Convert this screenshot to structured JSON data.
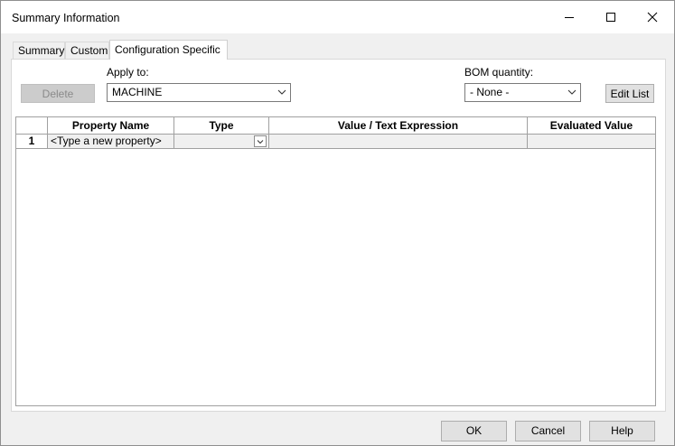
{
  "window": {
    "title": "Summary Information"
  },
  "tabs": [
    {
      "label": "Summary",
      "active": false
    },
    {
      "label": "Custom",
      "active": false
    },
    {
      "label": "Configuration Specific",
      "active": true
    }
  ],
  "toolbar": {
    "delete_label": "Delete",
    "apply_to_label": "Apply to:",
    "apply_to_value": "MACHINE",
    "bom_quantity_label": "BOM quantity:",
    "bom_quantity_value": "- None -",
    "edit_list_label": "Edit List"
  },
  "table": {
    "columns": [
      "",
      "Property Name",
      "Type",
      "Value / Text Expression",
      "Evaluated Value"
    ],
    "rows": [
      {
        "num": "1",
        "property_name": "<Type a new property>",
        "type": "",
        "value": "",
        "evaluated": ""
      }
    ]
  },
  "footer": {
    "ok_label": "OK",
    "cancel_label": "Cancel",
    "help_label": "Help"
  },
  "icons": {
    "minimize": "minimize-icon",
    "maximize": "maximize-icon",
    "close": "close-icon",
    "dropdown": "chevron-down-icon"
  }
}
